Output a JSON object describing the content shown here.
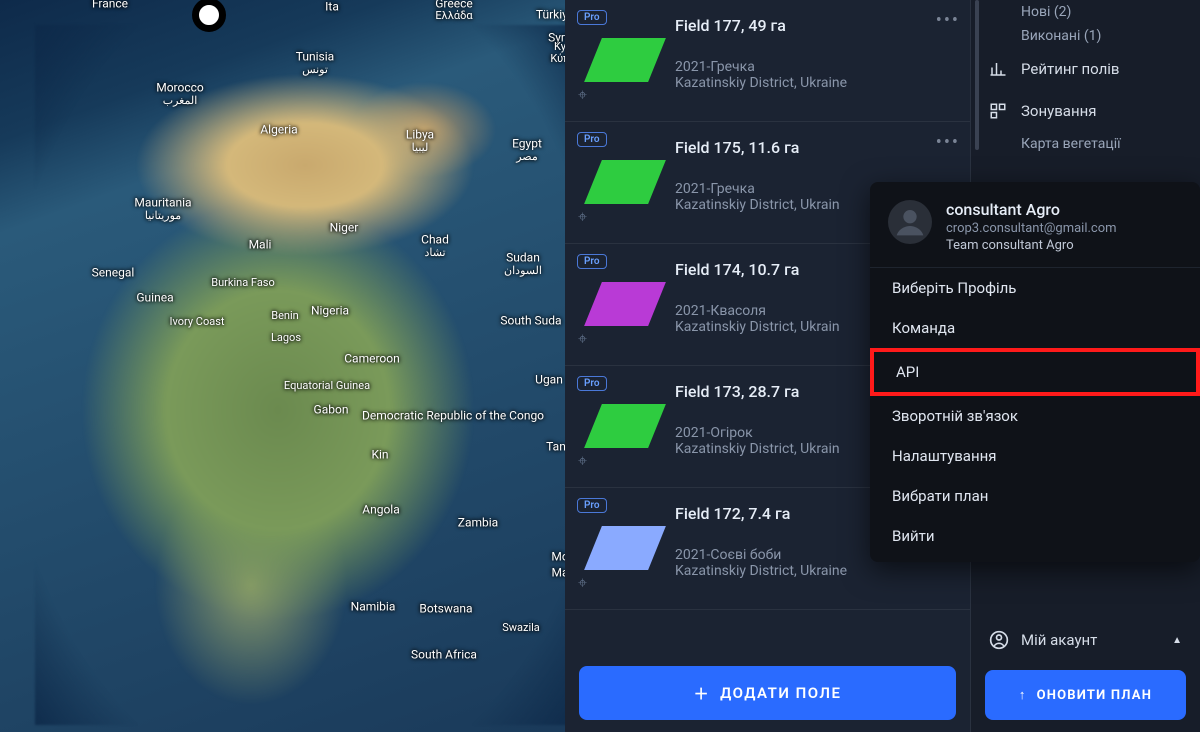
{
  "map": {
    "labels": [
      "France",
      "Greece",
      "Ελλάδα",
      "Ita",
      "Türkiye",
      "Syri",
      "Tunisia",
      "تونس",
      "Morocco",
      "المغرب",
      "Algeria",
      "Libya",
      "ليبيا",
      "Egypt",
      "مصر",
      "Mauritania",
      "موريتانيا",
      "Mali",
      "Niger",
      "Chad",
      "تشاد",
      "Sudan",
      "السودان",
      "Senegal",
      "Guinea",
      "Burkina Faso",
      "Benin",
      "Nigeria",
      "Ivory Coast",
      "Lagos",
      "Cameroon",
      "Equatorial Guinea",
      "Gabon",
      "Democratic Republic of the Congo",
      "South Suda",
      "Ugan",
      "Kin",
      "Tan",
      "Angola",
      "Zambia",
      "Namibia",
      "Botswana",
      "Swazila",
      "South Africa",
      "Mo",
      "Ma",
      "Ky",
      "Κύπ"
    ]
  },
  "fields": {
    "pro_label": "Pro",
    "items": [
      {
        "title": "Field 177, 49 га",
        "crop": "2021-Гречка",
        "loc": "Kazatinskiy District, Ukraine",
        "color": "#2ecc40",
        "show_more": true
      },
      {
        "title": "Field 175, 11.6 га",
        "crop": "2021-Гречка",
        "loc": "Kazatinskiy District, Ukrain",
        "color": "#2ecc40",
        "show_more": true
      },
      {
        "title": "Field 174, 10.7 га",
        "crop": "2021-Квасоля",
        "loc": "Kazatinskiy District, Ukrain",
        "color": "#b93ad6",
        "show_more": false
      },
      {
        "title": "Field 173, 28.7 га",
        "crop": "2021-Огірок",
        "loc": "Kazatinskiy District, Ukrain",
        "color": "#2ecc40",
        "show_more": false
      },
      {
        "title": "Field 172, 7.4 га",
        "crop": "2021-Соєві боби",
        "loc": "Kazatinskiy District, Ukraine",
        "color": "#8aaaff",
        "show_more": false
      }
    ],
    "add_button": "ДОДАТИ ПОЛЕ"
  },
  "rightnav": {
    "sub_new": "Нові (2)",
    "sub_done": "Виконані (1)",
    "rating": "Рейтинг полів",
    "zoning": "Зонування",
    "zoning_sub": "Карта вегетації",
    "account": "Мій акаунт",
    "update_plan": "ОНОВИТИ ПЛАН"
  },
  "popover": {
    "name": "consultant Agro",
    "email": "crop3.consultant@gmail.com",
    "team": "Team consultant Agro",
    "items": {
      "select_profile": "Виберіть Профіль",
      "team": "Команда",
      "api": "API",
      "feedback": "Зворотній зв'язок",
      "settings": "Налаштування",
      "choose_plan": "Вибрати план",
      "logout": "Вийти"
    }
  }
}
